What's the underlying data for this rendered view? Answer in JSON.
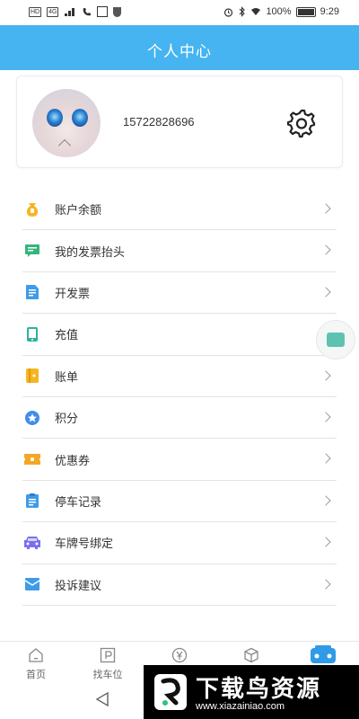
{
  "status_bar": {
    "left_badges": [
      "HD",
      "4G"
    ],
    "battery": "100%",
    "time": "9:29"
  },
  "header": {
    "title": "个人中心"
  },
  "profile": {
    "phone": "15722828696",
    "settings_icon": "gear-icon"
  },
  "menu": {
    "items": [
      {
        "label": "账户余额",
        "icon": "wallet-icon",
        "color": "#f5b623"
      },
      {
        "label": "我的发票抬头",
        "icon": "invoice-header-icon",
        "color": "#35b57c"
      },
      {
        "label": "开发票",
        "icon": "document-icon",
        "color": "#3f9be8"
      },
      {
        "label": "充值",
        "icon": "phone-icon",
        "color": "#2bb39b"
      },
      {
        "label": "账单",
        "icon": "bill-icon",
        "color": "#f5b623"
      },
      {
        "label": "积分",
        "icon": "star-icon",
        "color": "#3f8ee8"
      },
      {
        "label": "优惠券",
        "icon": "ticket-icon",
        "color": "#f5a623"
      },
      {
        "label": "停车记录",
        "icon": "clipboard-icon",
        "color": "#3f9be8"
      },
      {
        "label": "车牌号绑定",
        "icon": "car-icon",
        "color": "#7b6ef0"
      },
      {
        "label": "投诉建议",
        "icon": "mail-icon",
        "color": "#3f9be8"
      }
    ]
  },
  "tabbar": {
    "tabs": [
      {
        "label": "首页",
        "icon": "home-icon"
      },
      {
        "label": "找车位",
        "icon": "parking-icon"
      },
      {
        "label": "",
        "icon": "yen-icon"
      },
      {
        "label": "",
        "icon": "box-icon"
      },
      {
        "label": "",
        "icon": "car-front-icon",
        "active_color": "#2f9be8"
      }
    ]
  },
  "watermark": {
    "title": "下载鸟资源",
    "url": "www.xiazainiao.com"
  },
  "colors": {
    "header_bg": "#45b4f1",
    "accent": "#2f9be8"
  }
}
